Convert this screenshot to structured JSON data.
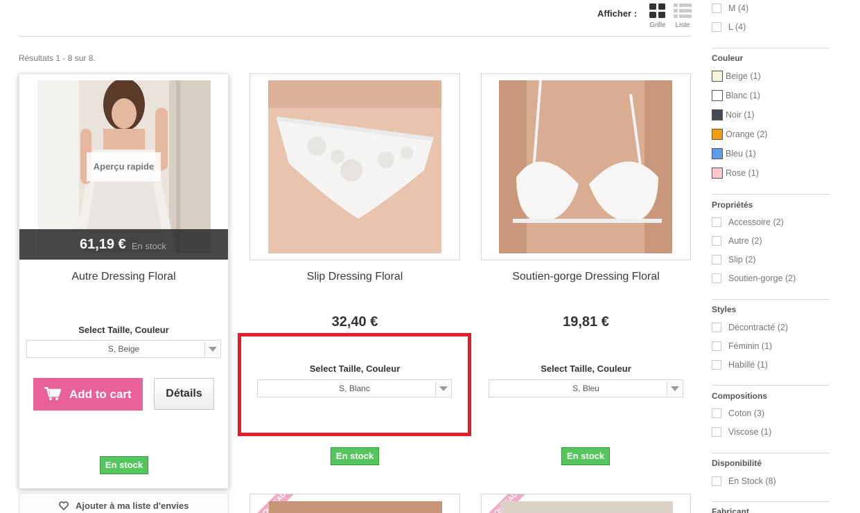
{
  "toolbar": {
    "afficher_label": "Afficher :",
    "grille_label": "Grille",
    "liste_label": "Liste"
  },
  "results_text": "Résultats 1 - 8 sur 8.",
  "products": [
    {
      "name": "Autre Dressing Floral",
      "price": "61,19 €",
      "overlay_stock": "En stock",
      "quick_view": "Aperçu rapide",
      "select_label": "Select Taille, Couleur",
      "select_value": "S, Beige",
      "add_to_cart": "Add to cart",
      "details": "Détails",
      "stock": "En stock",
      "wishlist": "Ajouter à ma liste d'envies"
    },
    {
      "name": "Slip Dressing Floral",
      "price": "32,40 €",
      "select_label": "Select Taille, Couleur",
      "select_value": "S, Blanc",
      "stock": "En stock"
    },
    {
      "name": "Soutien-gorge Dressing Floral",
      "price": "19,81 €",
      "select_label": "Select Taille, Couleur",
      "select_value": "S, Bleu",
      "stock": "En stock"
    }
  ],
  "next_row_ribbon": "NOUVEAU",
  "sidebar": {
    "sizes": [
      {
        "label": "M (4)"
      },
      {
        "label": "L (4)"
      }
    ],
    "couleur_title": "Couleur",
    "colors": [
      {
        "label": "Beige (1)",
        "color": "#f5f5dc"
      },
      {
        "label": "Blanc (1)",
        "color": "#ffffff"
      },
      {
        "label": "Noir (1)",
        "color": "#434a54"
      },
      {
        "label": "Orange (2)",
        "color": "#f39c11"
      },
      {
        "label": "Bleu (1)",
        "color": "#5d9cec"
      },
      {
        "label": "Rose (1)",
        "color": "#fccacd"
      }
    ],
    "proprietes_title": "Propriétés",
    "proprietes": [
      {
        "label": "Accessoire (2)"
      },
      {
        "label": "Autre (2)"
      },
      {
        "label": "Slip (2)"
      },
      {
        "label": "Soutien-gorge (2)"
      }
    ],
    "styles_title": "Styles",
    "styles": [
      {
        "label": "Décontracté (2)"
      },
      {
        "label": "Féminin (1)"
      },
      {
        "label": "Habillé (1)"
      }
    ],
    "compositions_title": "Compositions",
    "compositions": [
      {
        "label": "Coton (3)"
      },
      {
        "label": "Viscose (1)"
      }
    ],
    "disponibilite_title": "Disponibilité",
    "disponibilite": [
      {
        "label": "En Stock (8)"
      }
    ],
    "fabricant_title": "Fabricant"
  }
}
